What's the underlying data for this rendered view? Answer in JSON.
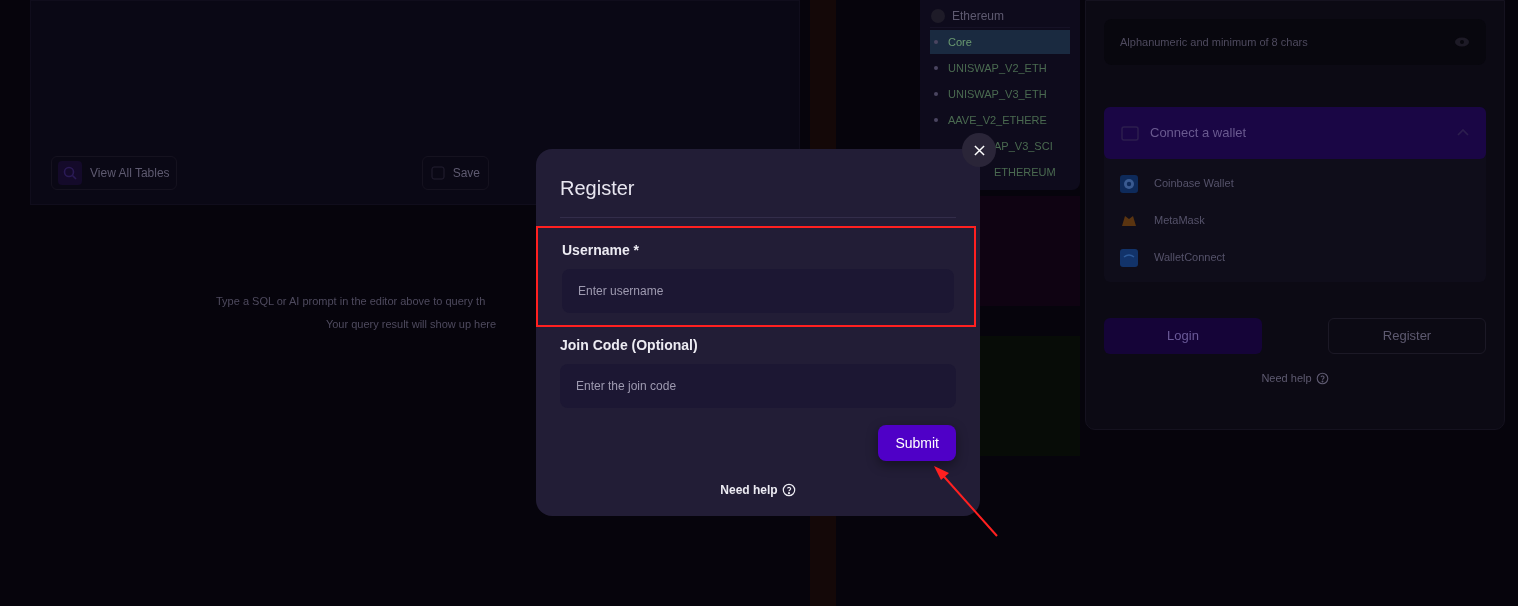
{
  "background": {
    "editor": {
      "view_tables_button": "View All Tables",
      "save_button": "Save"
    },
    "results_hint": [
      "Type a SQL or AI prompt in the editor above to query th",
      "Your query result will show up here"
    ],
    "chain_list": {
      "title": "Ethereum",
      "items": [
        {
          "label": "Core",
          "selected": true
        },
        {
          "label": "UNISWAP_V2_ETH",
          "selected": false
        },
        {
          "label": "UNISWAP_V3_ETH",
          "selected": false
        },
        {
          "label": "AAVE_V2_ETHERE",
          "selected": false
        },
        {
          "label": "AP_V3_SCI",
          "selected": false,
          "kind": "partial"
        },
        {
          "label": "ETHEREUM",
          "selected": false,
          "kind": "partial"
        }
      ]
    },
    "login_panel": {
      "password_placeholder": "Alphanumeric and minimum of 8 chars",
      "wallet_section": {
        "title": "Connect a wallet",
        "expanded": true,
        "wallets": [
          {
            "kind": "coinbase",
            "label": "Coinbase Wallet"
          },
          {
            "kind": "metamask",
            "label": "MetaMask"
          },
          {
            "kind": "walletconnect",
            "label": "WalletConnect"
          }
        ]
      },
      "login_button": "Login",
      "register_button": "Register",
      "help": "Need help"
    }
  },
  "modal": {
    "title": "Register",
    "fields": [
      {
        "label": "Username *",
        "placeholder": "Enter username",
        "highlighted": true
      },
      {
        "label": "Join Code (Optional)",
        "placeholder": "Enter the join code",
        "highlighted": false
      }
    ],
    "submit_button": "Submit",
    "help": "Need help"
  }
}
